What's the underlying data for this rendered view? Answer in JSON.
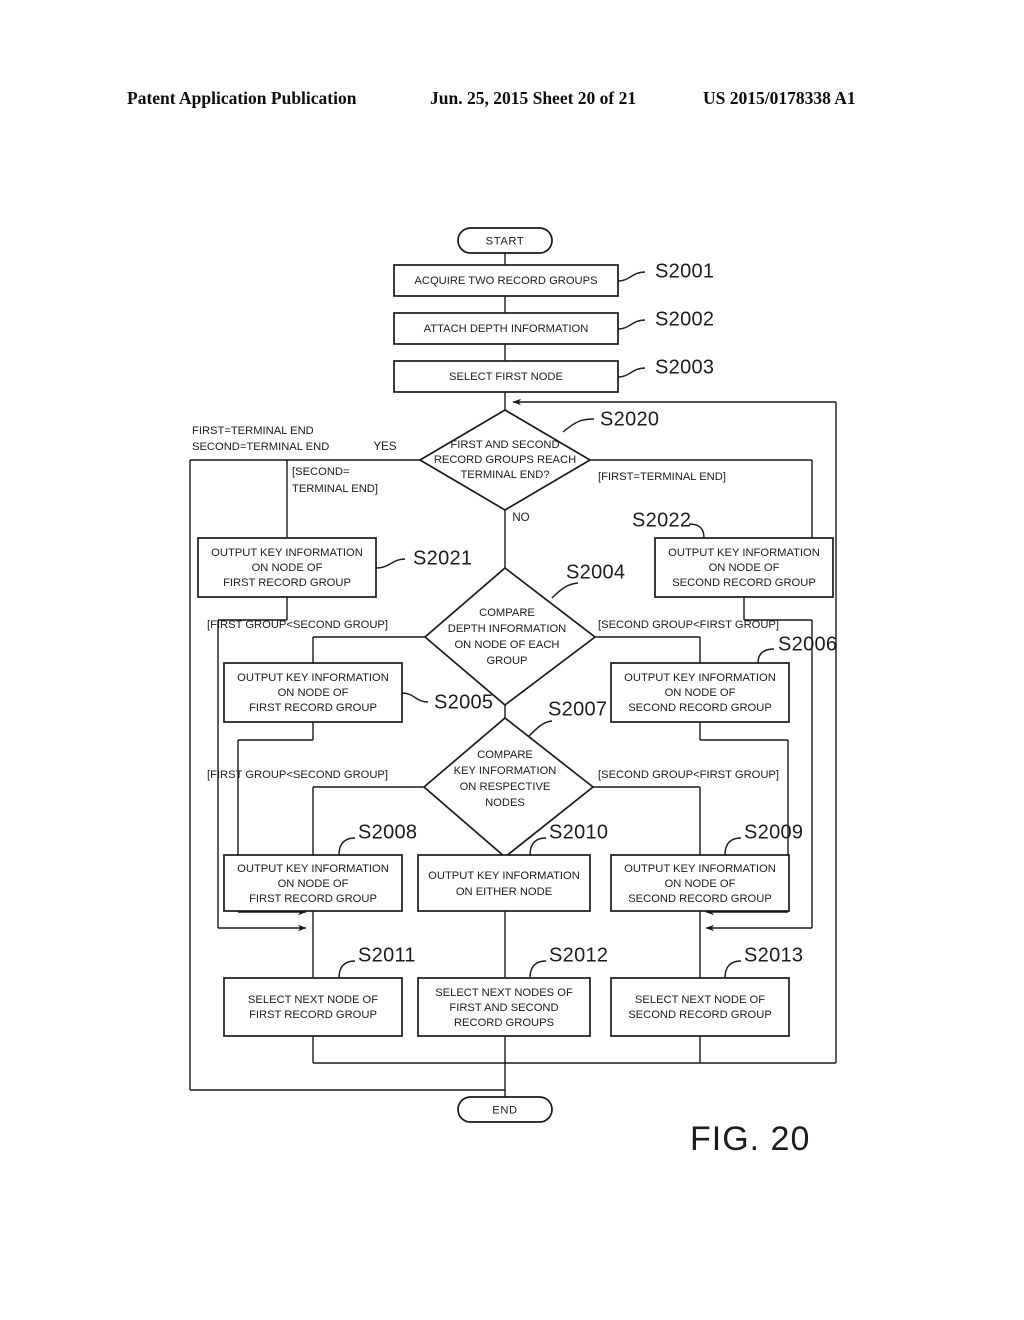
{
  "header": {
    "left": "Patent Application Publication",
    "middle": "Jun. 25, 2015  Sheet 20 of 21",
    "right": "US 2015/0178338 A1"
  },
  "figure": {
    "label": "FIG. 20"
  },
  "terminators": {
    "start": "START",
    "end": "END"
  },
  "nodes": {
    "s2001": {
      "ref": "S2001",
      "lines": [
        "ACQUIRE TWO RECORD GROUPS"
      ]
    },
    "s2002": {
      "ref": "S2002",
      "lines": [
        "ATTACH DEPTH INFORMATION"
      ]
    },
    "s2003": {
      "ref": "S2003",
      "lines": [
        "SELECT FIRST NODE"
      ]
    },
    "s2020": {
      "ref": "S2020",
      "lines": [
        "FIRST AND SECOND",
        "RECORD GROUPS REACH",
        "TERMINAL END?"
      ]
    },
    "s2021": {
      "ref": "S2021",
      "lines": [
        "OUTPUT KEY INFORMATION",
        "ON NODE OF",
        "FIRST RECORD GROUP"
      ]
    },
    "s2022": {
      "ref": "S2022",
      "lines": [
        "OUTPUT KEY INFORMATION",
        "ON NODE OF",
        "SECOND RECORD GROUP"
      ]
    },
    "s2004": {
      "ref": "S2004",
      "lines": [
        "COMPARE",
        "DEPTH INFORMATION",
        "ON NODE OF EACH",
        "GROUP"
      ]
    },
    "s2005": {
      "ref": "S2005",
      "lines": [
        "OUTPUT KEY INFORMATION",
        "ON NODE OF",
        "FIRST RECORD GROUP"
      ]
    },
    "s2006": {
      "ref": "S2006",
      "lines": [
        "OUTPUT KEY INFORMATION",
        "ON NODE OF",
        "SECOND RECORD GROUP"
      ]
    },
    "s2007": {
      "ref": "S2007",
      "lines": [
        "COMPARE",
        "KEY INFORMATION",
        "ON RESPECTIVE",
        "NODES"
      ]
    },
    "s2008": {
      "ref": "S2008",
      "lines": [
        "OUTPUT KEY INFORMATION",
        "ON NODE OF",
        "FIRST RECORD GROUP"
      ]
    },
    "s2010": {
      "ref": "S2010",
      "lines": [
        "OUTPUT KEY INFORMATION",
        "ON EITHER NODE"
      ]
    },
    "s2009": {
      "ref": "S2009",
      "lines": [
        "OUTPUT KEY INFORMATION",
        "ON NODE OF",
        "SECOND RECORD GROUP"
      ]
    },
    "s2011": {
      "ref": "S2011",
      "lines": [
        "SELECT NEXT NODE OF",
        "FIRST RECORD GROUP"
      ]
    },
    "s2012": {
      "ref": "S2012",
      "lines": [
        "SELECT NEXT NODES OF",
        "FIRST AND SECOND",
        "RECORD GROUPS"
      ]
    },
    "s2013": {
      "ref": "S2013",
      "lines": [
        "SELECT NEXT NODE OF",
        "SECOND RECORD GROUP"
      ]
    }
  },
  "edge_labels": {
    "yes": "YES",
    "no": "NO",
    "both_terminal_1": "FIRST=TERMINAL END",
    "both_terminal_2": "SECOND=TERMINAL END",
    "second_terminal_1": "[SECOND=",
    "second_terminal_2": "TERMINAL END]",
    "first_terminal": "[FIRST=TERMINAL END]",
    "depth_left": "[FIRST GROUP<SECOND GROUP]",
    "depth_right": "[SECOND GROUP<FIRST GROUP]",
    "key_left": "[FIRST GROUP<SECOND GROUP]",
    "key_right": "[SECOND GROUP<FIRST GROUP]"
  }
}
